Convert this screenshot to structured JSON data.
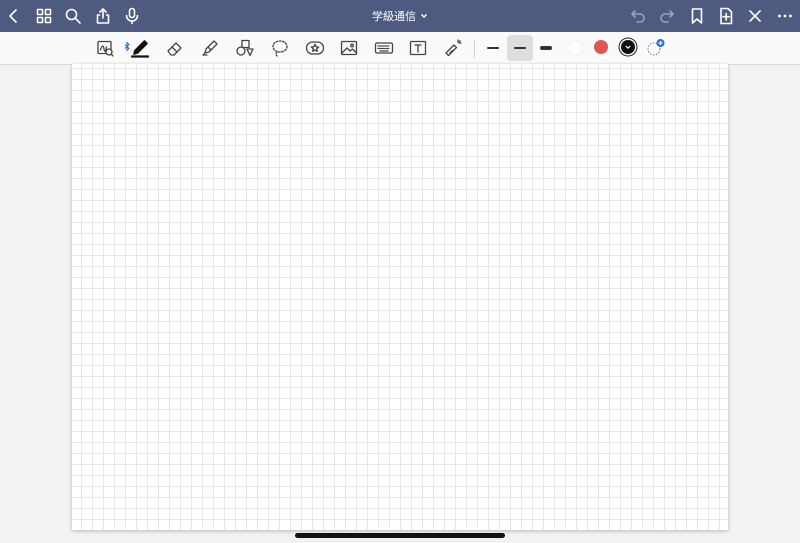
{
  "topbar": {
    "title": "学級通信",
    "bg_color": "#4f5a80",
    "left_icons": [
      "back-icon",
      "grid-icon",
      "search-icon",
      "share-icon",
      "microphone-icon"
    ],
    "right_icons": [
      "undo-icon",
      "redo-icon",
      "bookmark-icon",
      "add-page-icon",
      "close-icon",
      "more-icon"
    ]
  },
  "toolbar": {
    "tools": [
      "scan-tool-icon",
      "pen-icon",
      "eraser-icon",
      "highlighter-icon",
      "shapes-icon",
      "lasso-icon",
      "sticker-icon",
      "image-icon",
      "keyboard-icon",
      "text-box-icon",
      "laser-pointer-icon"
    ],
    "active_tool": "pen-icon",
    "stroke_widths": [
      "thin",
      "medium",
      "thick"
    ],
    "selected_stroke": "medium",
    "colors": [
      "#ffffff",
      "#e05555",
      "#111111"
    ],
    "selected_color": "#111111",
    "accent": "#2a6de0"
  },
  "page": {
    "paper": "grid"
  }
}
